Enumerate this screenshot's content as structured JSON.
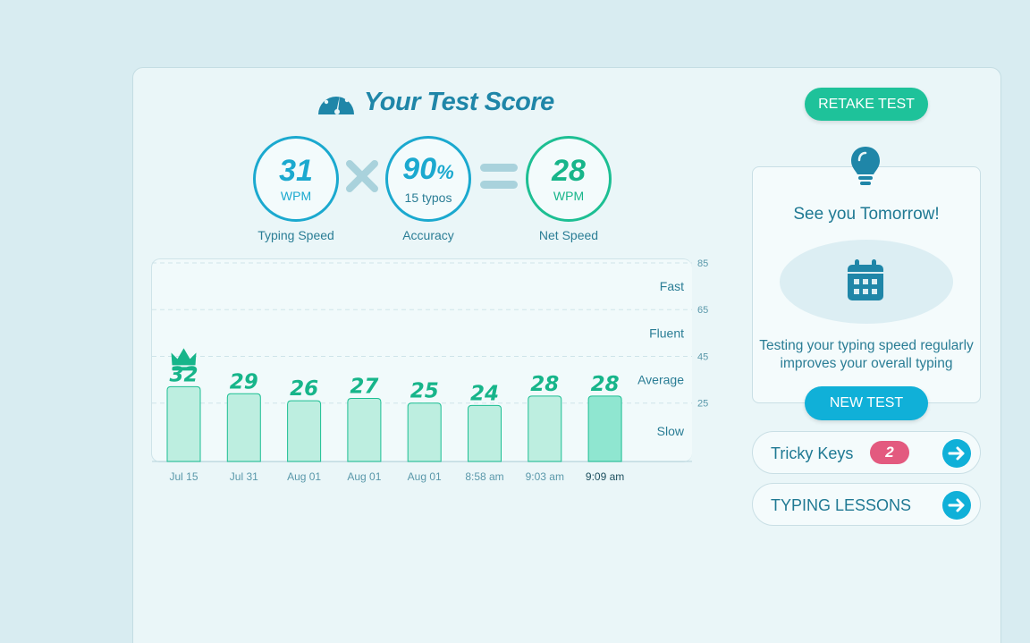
{
  "header": {
    "title": "Your Test Score",
    "icon": "speedometer-icon"
  },
  "stats": {
    "typing_speed": {
      "value": "31",
      "unit": "WPM",
      "label": "Typing Speed"
    },
    "accuracy": {
      "value": "90",
      "suffix": "%",
      "sub": "15 typos",
      "label": "Accuracy"
    },
    "net_speed": {
      "value": "28",
      "unit": "WPM",
      "label": "Net Speed"
    }
  },
  "buttons": {
    "retake": "RETAKE TEST",
    "new_test": "NEW TEST"
  },
  "tomorrow": {
    "heading": "See you Tomorrow!",
    "tip_line1": "Testing your typing speed regularly",
    "tip_line2": "improves your overall typing"
  },
  "tricky_keys": {
    "label": "Tricky Keys",
    "count": "2"
  },
  "lessons": {
    "label": "TYPING LESSONS"
  },
  "colors": {
    "accent_blue": "#1ba9cf",
    "accent_green": "#1ec29a",
    "badge_red": "#e35a7f",
    "bar_fill": "#bdeee0",
    "bar_current": "#8fe6d0"
  },
  "chart_data": {
    "type": "bar",
    "categories": [
      "Jul 15",
      "Jul 31",
      "Aug 01",
      "Aug 01",
      "Aug 01",
      "8:58 am",
      "9:03 am",
      "9:09 am"
    ],
    "values": [
      32,
      29,
      26,
      27,
      25,
      24,
      28,
      28
    ],
    "highlight_index": 7,
    "best_index": 0,
    "ylim": [
      0,
      85
    ],
    "ticks": [
      25,
      45,
      65,
      85
    ],
    "bands": [
      {
        "label": "Fast",
        "value": 75
      },
      {
        "label": "Fluent",
        "value": 55
      },
      {
        "label": "Average",
        "value": 35
      },
      {
        "label": "Slow",
        "value": 13
      }
    ],
    "grid": true
  }
}
